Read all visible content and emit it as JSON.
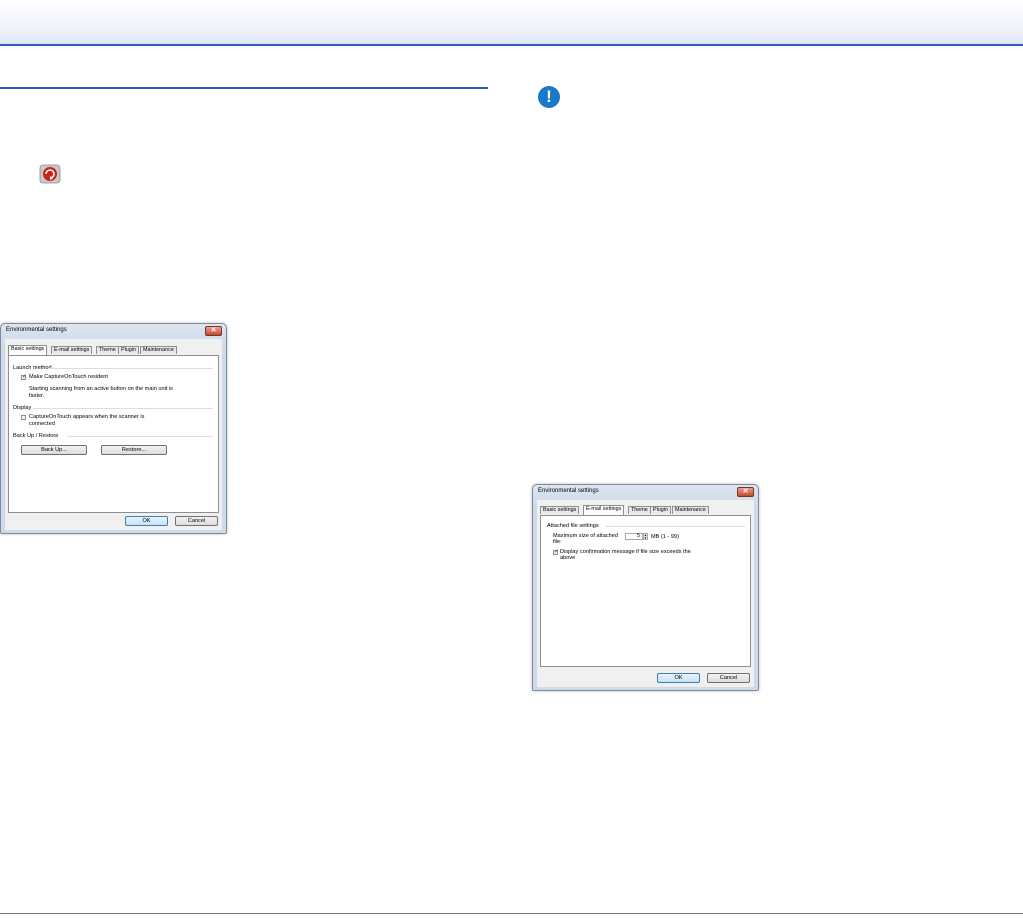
{
  "dialog_basic": {
    "title": "Environmental settings",
    "close_glyph": "✕",
    "tabs": [
      "Basic settings",
      "E-mail settings",
      "Theme",
      "Plugin",
      "Maintenance"
    ],
    "launch_group": "Launch method",
    "make_resident_label": "Make CaptureOnTouch resident",
    "make_resident_checked": true,
    "resident_note_line1": "Starting scanning from an active button on the main unit is",
    "resident_note_line2": "faster.",
    "display_group": "Display",
    "appears_label_line1": "CaptureOnTouch appears when the scanner is",
    "appears_label_line2": "connected",
    "appears_checked": false,
    "backup_group": "Back Up / Restore",
    "backup_button": "Back Up...",
    "restore_button": "Restore...",
    "ok_button": "OK",
    "cancel_button": "Cancel"
  },
  "dialog_email": {
    "title": "Environmental settings",
    "close_glyph": "✕",
    "tabs": [
      "Basic settings",
      "E-mail settings",
      "Theme",
      "Plugin",
      "Maintenance"
    ],
    "attached_group": "Attached file settings",
    "max_size_label_line1": "Maximum size of attached",
    "max_size_label_line2": "file:",
    "max_size_value": "5",
    "max_size_unit": "MB (1 - 99)",
    "confirm_label_line1": "Display confirmation message if file size exceeds the",
    "confirm_label_line2": "above",
    "confirm_checked": true,
    "ok_button": "OK",
    "cancel_button": "Cancel"
  },
  "icons": {
    "notice": "!",
    "app": "captureontouch-icon"
  },
  "colors": {
    "accent_rule": "#2f5fb0",
    "notice_icon": "#1a78c9"
  }
}
